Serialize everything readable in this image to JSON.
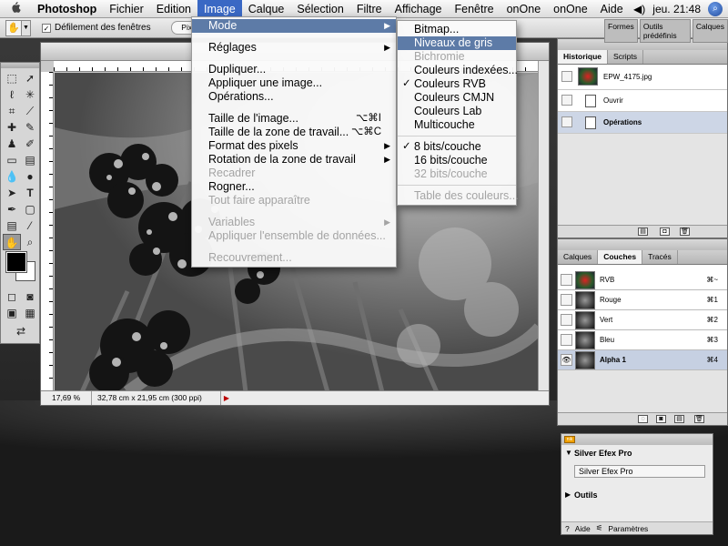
{
  "menubar": {
    "apple": "",
    "app": "Photoshop",
    "items": [
      "Fichier",
      "Edition",
      "Image",
      "Calque",
      "Sélection",
      "Filtre",
      "Affichage",
      "Fenêtre",
      "onOne",
      "onOne",
      "Aide"
    ],
    "active_index": 2,
    "volume_icon": "speaker-icon",
    "clock": "jeu. 21:48"
  },
  "options_bar": {
    "checkbox_label": "Défilement des fenêtres",
    "pixels_button": "Pixels",
    "palette_well_tabs": [
      "Formes",
      "Outils prédéfinis",
      "Calques"
    ]
  },
  "image_menu": {
    "items": [
      {
        "label": "Mode",
        "type": "submenu",
        "highlighted": true
      },
      {
        "type": "gap"
      },
      {
        "label": "Réglages",
        "type": "submenu"
      },
      {
        "type": "gap"
      },
      {
        "label": "Dupliquer..."
      },
      {
        "label": "Appliquer une image..."
      },
      {
        "label": "Opérations..."
      },
      {
        "type": "gap"
      },
      {
        "label": "Taille de l'image...",
        "shortcut": "⌥⌘I"
      },
      {
        "label": "Taille de la zone de travail...",
        "shortcut": "⌥⌘C"
      },
      {
        "label": "Format des pixels",
        "type": "submenu"
      },
      {
        "label": "Rotation de la zone de travail",
        "type": "submenu"
      },
      {
        "label": "Recadrer",
        "disabled": true
      },
      {
        "label": "Rogner..."
      },
      {
        "label": "Tout faire apparaître",
        "disabled": true
      },
      {
        "type": "gap"
      },
      {
        "label": "Variables",
        "type": "submenu",
        "disabled": true
      },
      {
        "label": "Appliquer l'ensemble de données...",
        "disabled": true
      },
      {
        "type": "gap"
      },
      {
        "label": "Recouvrement...",
        "disabled": true
      }
    ]
  },
  "mode_submenu": {
    "items": [
      {
        "label": "Bitmap..."
      },
      {
        "label": "Niveaux de gris",
        "highlighted": true
      },
      {
        "label": "Bichromie",
        "disabled": true
      },
      {
        "label": "Couleurs indexées..."
      },
      {
        "label": "Couleurs RVB",
        "checked": true
      },
      {
        "label": "Couleurs CMJN"
      },
      {
        "label": "Couleurs Lab"
      },
      {
        "label": "Multicouche"
      },
      {
        "type": "sep"
      },
      {
        "label": "8 bits/couche",
        "checked": true
      },
      {
        "label": "16 bits/couche"
      },
      {
        "label": "32 bits/couche",
        "disabled": true
      },
      {
        "type": "sep"
      },
      {
        "label": "Table des couleurs...",
        "disabled": true
      }
    ]
  },
  "document": {
    "zoom": "17,69 %",
    "doc_size": "32,78 cm x 21,95 cm (300 ppi)"
  },
  "history_panel": {
    "tabs": [
      "Historique",
      "Scripts"
    ],
    "snapshot_label": "EPW_4175.jpg",
    "states": [
      "Ouvrir",
      "Opérations"
    ]
  },
  "channels_panel": {
    "tabs": [
      "Calques",
      "Couches",
      "Tracés"
    ],
    "channels": [
      {
        "name": "RVB",
        "shortcut": "⌘~",
        "thumb": "color"
      },
      {
        "name": "Rouge",
        "shortcut": "⌘1",
        "thumb": "gray"
      },
      {
        "name": "Vert",
        "shortcut": "⌘2",
        "thumb": "gray"
      },
      {
        "name": "Bleu",
        "shortcut": "⌘3",
        "thumb": "gray"
      },
      {
        "name": "Alpha 1",
        "shortcut": "⌘4",
        "thumb": "gray",
        "selected": true
      }
    ]
  },
  "silver_efex_panel": {
    "title": "Silver Efex Pro",
    "button": "Silver Efex Pro",
    "section": "Outils",
    "help": "Aide",
    "params": "Paramètres"
  },
  "colors": {
    "menu_highlight": "#5d7ba7",
    "menubar_active": "#3a68c4"
  }
}
